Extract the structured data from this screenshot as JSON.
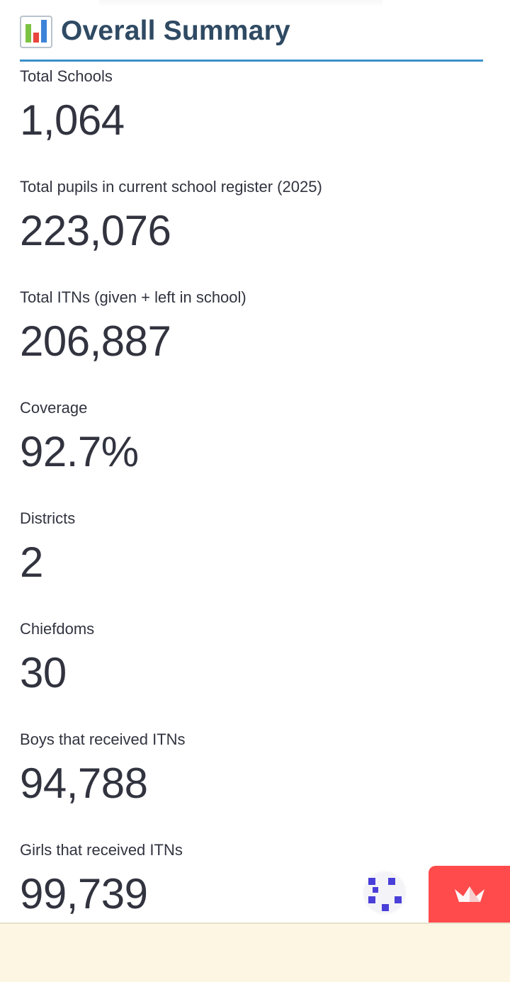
{
  "header": {
    "icon": "bar-chart-icon",
    "title": "Overall Summary"
  },
  "metrics": [
    {
      "label": "Total Schools",
      "value": "1,064"
    },
    {
      "label": "Total pupils in current school register (2025)",
      "value": "223,076"
    },
    {
      "label": "Total ITNs (given + left in school)",
      "value": "206,887"
    },
    {
      "label": "Coverage",
      "value": "92.7%"
    },
    {
      "label": "Districts",
      "value": "2"
    },
    {
      "label": "Chiefdoms",
      "value": "30"
    },
    {
      "label": "Boys that received ITNs",
      "value": "94,788"
    },
    {
      "label": "Girls that received ITNs",
      "value": "99,739"
    }
  ],
  "widgets": {
    "status_icon": "running-status-icon",
    "deploy_icon": "crown-icon"
  },
  "colors": {
    "accent_rule": "#3b91c9",
    "title": "#2f4a63",
    "text": "#31333f",
    "deploy": "#ff4b4b",
    "status_dots": "#4b3fd9",
    "bottom_bar": "#fdf6e3"
  }
}
